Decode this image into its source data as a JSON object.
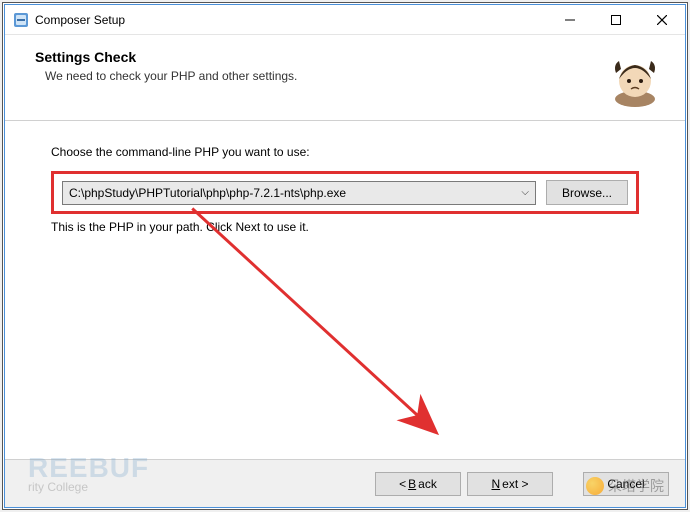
{
  "titlebar": {
    "title": "Composer Setup"
  },
  "header": {
    "heading": "Settings Check",
    "subtext": "We need to check your PHP and other settings."
  },
  "body": {
    "choose_label": "Choose the command-line PHP you want to use:",
    "path_value": "C:\\phpStudy\\PHPTutorial\\php\\php-7.2.1-nts\\php.exe",
    "browse_label": "Browse...",
    "hint": "This is the PHP in your path. Click Next to use it."
  },
  "footer": {
    "back_prefix": "< ",
    "back_letter": "B",
    "back_rest": "ack",
    "next_letter": "N",
    "next_rest": "ext >",
    "cancel_label": "Cancel"
  },
  "watermark": {
    "wm1_line1": "REEBUF",
    "wm1_line2": "rity College",
    "wm2": "朵塔学院"
  }
}
